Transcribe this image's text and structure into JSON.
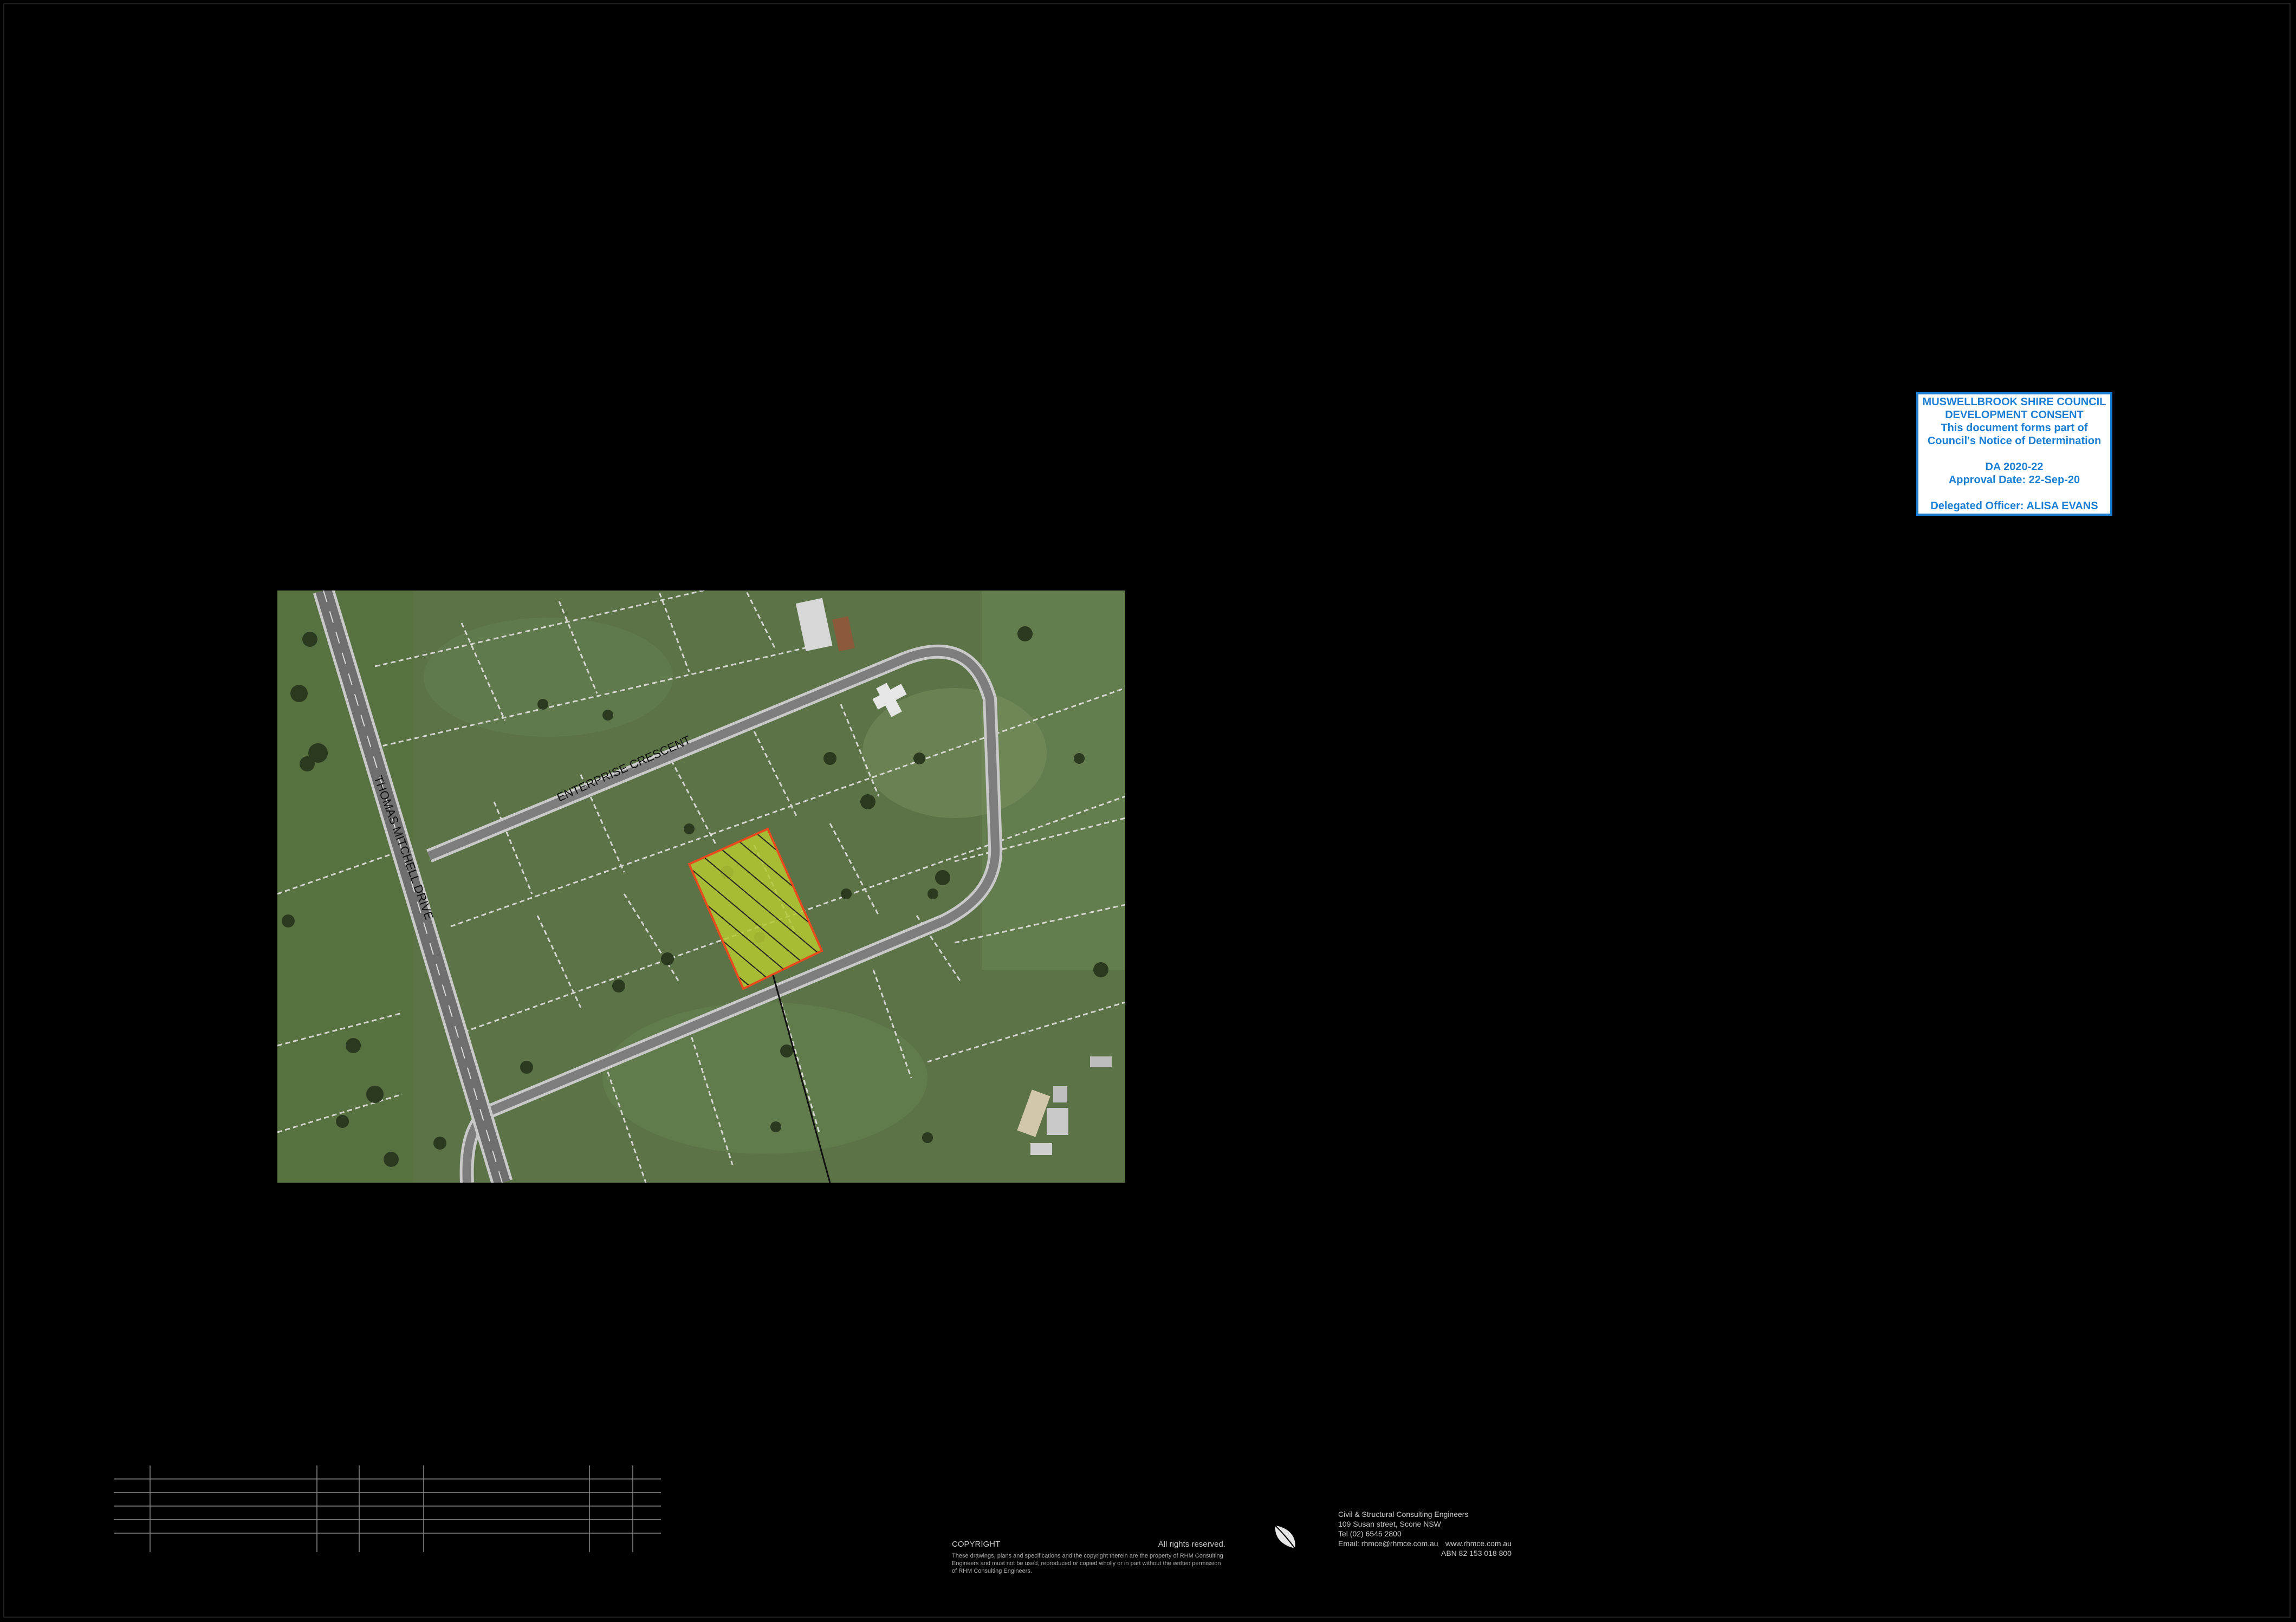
{
  "stamp": {
    "line1": "MUSWELLBROOK SHIRE COUNCIL",
    "line2": "DEVELOPMENT CONSENT",
    "line3": "This document forms part of",
    "line4": "Council's Notice of Determination",
    "da_number": "DA 2020-22",
    "approval_date": "Approval Date: 22-Sep-20",
    "officer": "Delegated Officer: ALISA EVANS",
    "border_color": "#1a7fd4"
  },
  "map": {
    "road_1": "THOMAS MITCHELL DRIVE",
    "road_2": "ENTERPRISE CRESCENT",
    "highlight_color": "#b5c832",
    "boundary_color": "#e84a1e"
  },
  "copyright": {
    "title": "COPYRIGHT",
    "rights": "All rights reserved.",
    "notice": "These drawings, plans and specifications and the copyright therein are the property of RHM Consulting Engineers and must not be used, reproduced or copied wholly or in part without the written permission of RHM Consulting Engineers."
  },
  "firm": {
    "tagline": "Civil & Structural Consulting Engineers",
    "address": "109 Susan street, Scone NSW",
    "phone": "Tel (02) 6545 2800",
    "email": "Email: rhmce@rhmce.com.au",
    "website": "www.rhmce.com.au",
    "abn": "ABN 82 153 018 800"
  }
}
